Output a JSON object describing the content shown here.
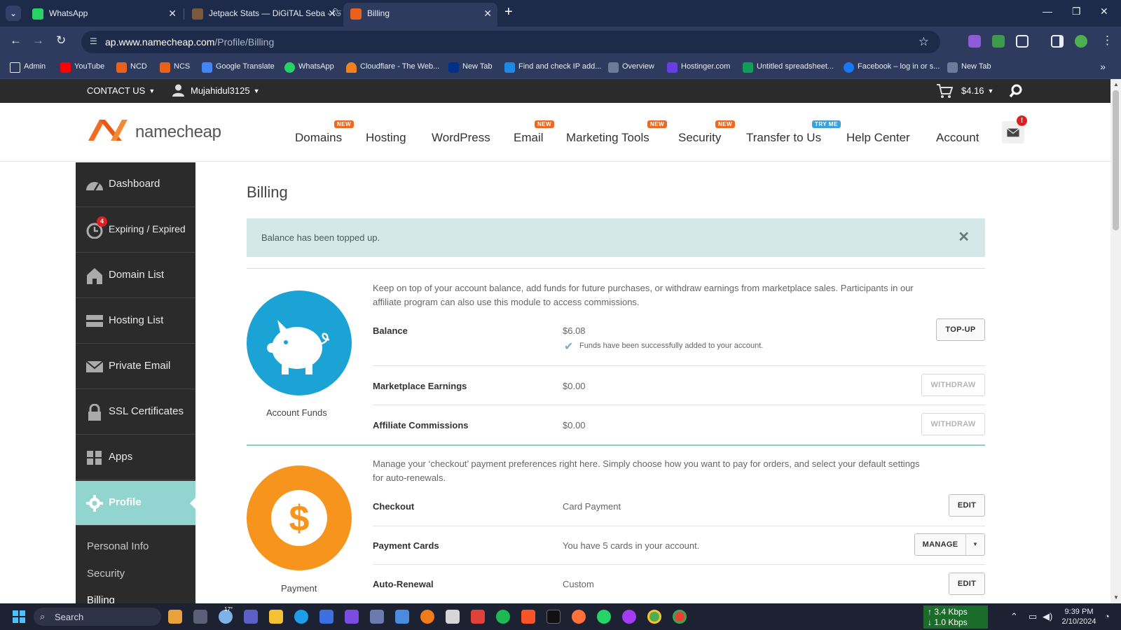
{
  "browser": {
    "tabs": [
      {
        "title": "WhatsApp",
        "color": "#25d366"
      },
      {
        "title": "Jetpack Stats — DiGiTAL Seba - ডি",
        "color": "#7a5a3a"
      },
      {
        "title": "Billing",
        "color": "#e8621c"
      }
    ],
    "new_tab_glyph": "+",
    "url_host": "ap.www.namecheap.com",
    "url_path": "/Profile/Billing",
    "bookmarks": [
      {
        "label": "Admin",
        "icon": "folder-icon",
        "color": "#2f3b5e"
      },
      {
        "label": "YouTube",
        "icon": "youtube-icon",
        "color": "#ff0000"
      },
      {
        "label": "NCD",
        "icon": "namecheap-icon",
        "color": "#e8621c"
      },
      {
        "label": "NCS",
        "icon": "namecheap-icon",
        "color": "#e8621c"
      },
      {
        "label": "Google Translate",
        "icon": "translate-icon",
        "color": "#4285f4"
      },
      {
        "label": "WhatsApp",
        "icon": "whatsapp-icon",
        "color": "#25d366"
      },
      {
        "label": "Cloudflare - The Web...",
        "icon": "cloudflare-icon",
        "color": "#f38020"
      },
      {
        "label": "New Tab",
        "icon": "paypal-icon",
        "color": "#003087"
      },
      {
        "label": "Find and check IP add...",
        "icon": "w-icon",
        "color": "#1e88e5"
      },
      {
        "label": "Overview",
        "icon": "overview-icon",
        "color": "#6d7a99"
      },
      {
        "label": "Hostinger.com",
        "icon": "hostinger-icon",
        "color": "#673de6"
      },
      {
        "label": "Untitled spreadsheet...",
        "icon": "drive-icon",
        "color": "#0f9d58"
      },
      {
        "label": "Facebook – log in or s...",
        "icon": "facebook-icon",
        "color": "#1877f2"
      },
      {
        "label": "New Tab",
        "icon": "newtab-icon",
        "color": "#6d7a99"
      }
    ]
  },
  "topbar": {
    "contact": "CONTACT US",
    "username": "Mujahidul3125",
    "balance": "$4.16"
  },
  "header": {
    "logo_text": "namecheap",
    "nav": [
      {
        "label": "Domains",
        "badge": "NEW"
      },
      {
        "label": "Hosting",
        "badge": ""
      },
      {
        "label": "WordPress",
        "badge": ""
      },
      {
        "label": "Email",
        "badge": "NEW"
      },
      {
        "label": "Marketing Tools",
        "badge": "NEW"
      },
      {
        "label": "Security",
        "badge": "NEW"
      },
      {
        "label": "Transfer to Us",
        "badge": "TRY ME"
      },
      {
        "label": "Help Center",
        "badge": ""
      },
      {
        "label": "Account",
        "badge": ""
      }
    ],
    "mail_badge": "!"
  },
  "sidebar": {
    "items": [
      {
        "label": "Dashboard",
        "icon": "gauge-icon"
      },
      {
        "label": "Expiring / Expired",
        "icon": "alarm-clock-icon",
        "badge": "4"
      },
      {
        "label": "Domain List",
        "icon": "house-icon"
      },
      {
        "label": "Hosting List",
        "icon": "server-icon"
      },
      {
        "label": "Private Email",
        "icon": "envelope-icon"
      },
      {
        "label": "SSL Certificates",
        "icon": "lock-icon"
      },
      {
        "label": "Apps",
        "icon": "apps-icon"
      },
      {
        "label": "Profile",
        "icon": "gear-icon"
      }
    ],
    "subitems": [
      {
        "label": "Personal Info"
      },
      {
        "label": "Security"
      },
      {
        "label": "Billing"
      }
    ]
  },
  "main": {
    "title": "Billing",
    "alert": "Balance has been topped up.",
    "funds": {
      "section_label": "Account Funds",
      "description": "Keep on top of your account balance, add funds for future purchases, or withdraw earnings from marketplace sales. Participants in our affiliate program can also use this module to access commissions.",
      "rows": [
        {
          "label": "Balance",
          "value": "$6.08",
          "button": "TOP-UP"
        },
        {
          "label": "Marketplace Earnings",
          "value": "$0.00",
          "button": "WITHDRAW"
        },
        {
          "label": "Affiliate Commissions",
          "value": "$0.00",
          "button": "WITHDRAW"
        }
      ],
      "success_note": "Funds have been successfully added to your account."
    },
    "payment": {
      "section_label": "Payment",
      "description": "Manage your ‘checkout’ payment preferences right here. Simply choose how you want to pay for orders, and select your default settings for auto-renewals.",
      "rows": [
        {
          "label": "Checkout",
          "value": "Card Payment",
          "button": "EDIT"
        },
        {
          "label": "Payment Cards",
          "value": "You have 5 cards in your account.",
          "button": "MANAGE"
        },
        {
          "label": "Auto-Renewal",
          "value": "Custom",
          "button": "EDIT"
        }
      ]
    }
  },
  "taskbar": {
    "search": "Search",
    "weather": "17°",
    "net_up": "↑ 3.4 Kbps",
    "net_down": "↓ 1.0 Kbps",
    "time": "9:39 PM",
    "date": "2/10/2024"
  },
  "colors": {
    "brand": "#e8621c",
    "accent_teal": "#91d4d0",
    "funds_circle": "#1aa3d4",
    "payment_circle": "#f7941d"
  }
}
